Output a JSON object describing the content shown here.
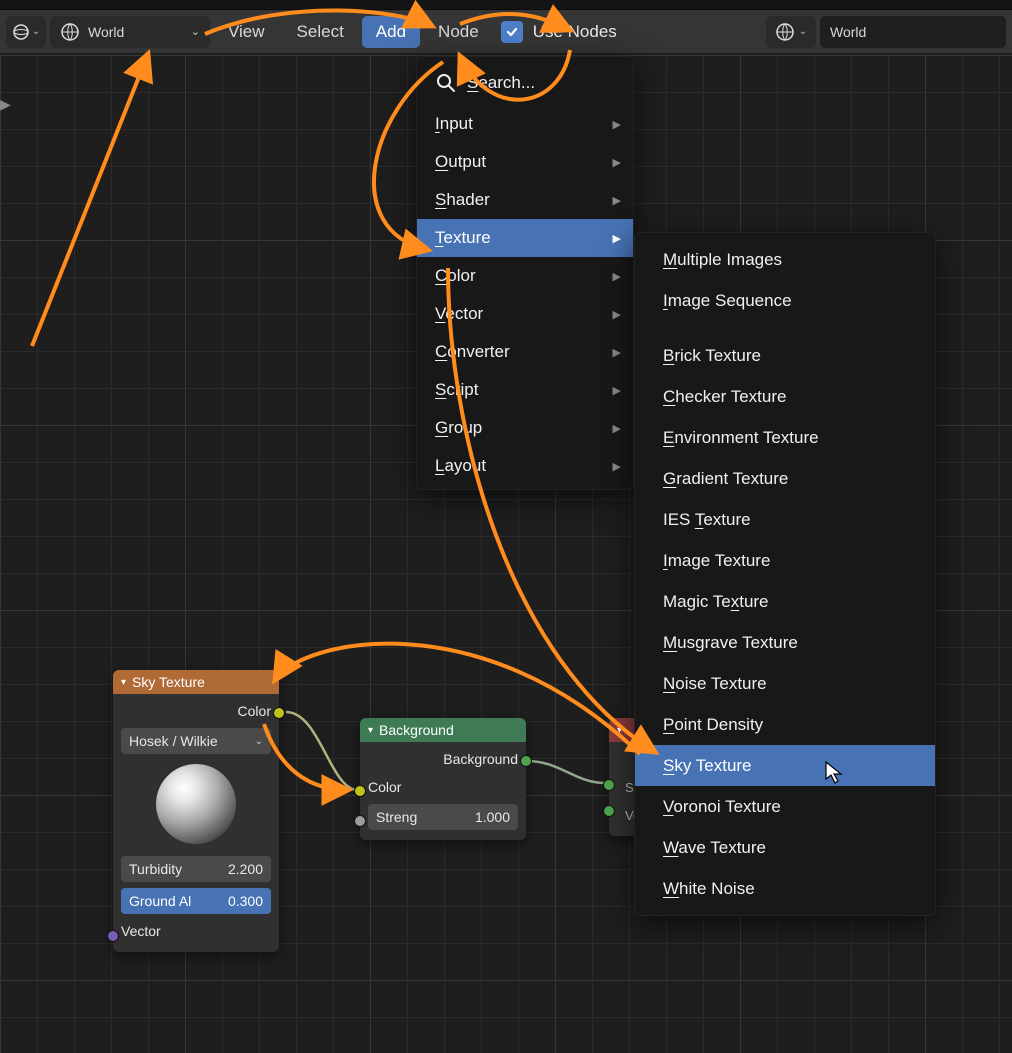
{
  "header": {
    "world_selector": "World",
    "menus": {
      "view": "View",
      "select": "Select",
      "add": "Add",
      "node": "Node"
    },
    "use_nodes": "Use Nodes",
    "right_selector": "World"
  },
  "menu1": {
    "search": "Search...",
    "items": [
      {
        "label": "Input",
        "u": "I"
      },
      {
        "label": "Output",
        "u": "O"
      },
      {
        "label": "Shader",
        "u": "S"
      },
      {
        "label": "Texture",
        "u": "T",
        "highlight": true
      },
      {
        "label": "Color",
        "u": "C"
      },
      {
        "label": "Vector",
        "u": "V"
      },
      {
        "label": "Converter",
        "u": "C"
      },
      {
        "label": "Script",
        "u": "S"
      },
      {
        "label": "Group",
        "u": "G"
      },
      {
        "label": "Layout",
        "u": "L"
      }
    ]
  },
  "menu2": {
    "top": [
      {
        "label": "Multiple Images",
        "u": "M"
      },
      {
        "label": "Image Sequence",
        "u": "I"
      }
    ],
    "textures": [
      {
        "label": "Brick Texture",
        "u": "B"
      },
      {
        "label": "Checker Texture",
        "u": "C"
      },
      {
        "label": "Environment Texture",
        "u": "E"
      },
      {
        "label": "Gradient Texture",
        "u": "G"
      },
      {
        "label": "IES Texture",
        "u": "T",
        "before": "IES "
      },
      {
        "label": "Image Texture",
        "u": "I"
      },
      {
        "label": "Magic Texture",
        "u": "x",
        "before": "Magic Te"
      },
      {
        "label": "Musgrave Texture",
        "u": "M"
      },
      {
        "label": "Noise Texture",
        "u": "N"
      },
      {
        "label": "Point Density",
        "u": "P"
      },
      {
        "label": "Sky Texture",
        "u": "S",
        "highlight": true
      },
      {
        "label": "Voronoi Texture",
        "u": "V"
      },
      {
        "label": "Wave Texture",
        "u": "W"
      },
      {
        "label": "White Noise",
        "u": "W"
      }
    ]
  },
  "nodes": {
    "sky": {
      "title": "Sky Texture",
      "output": "Color",
      "model": "Hosek / Wilkie",
      "turbidity_label": "Turbidity",
      "turbidity_val": "2.200",
      "ground_label": "Ground Al",
      "ground_val": "0.300",
      "vector": "Vector"
    },
    "bg": {
      "title": "Background",
      "out": "Background",
      "color": "Color",
      "strength_label": "Streng",
      "strength_val": "1.000"
    },
    "worldout": {
      "surface": "Surface",
      "volume": "Volume"
    }
  }
}
